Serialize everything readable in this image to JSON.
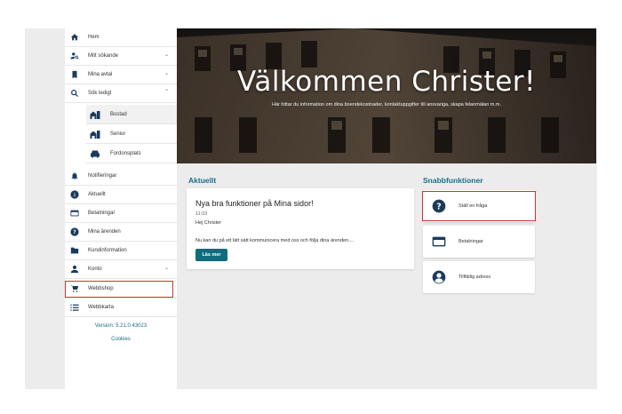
{
  "sidebar": {
    "items": [
      {
        "label": "Hem",
        "icon": "home-icon"
      },
      {
        "label": "Mitt sökande",
        "icon": "person-search-icon"
      },
      {
        "label": "Mina avtal",
        "icon": "book-icon"
      },
      {
        "label": "Sök ledigt",
        "icon": "search-icon"
      },
      {
        "label": "Notifieringar",
        "icon": "bell-icon"
      },
      {
        "label": "Aktuellt",
        "icon": "info-icon"
      },
      {
        "label": "Betalningar",
        "icon": "credit-card-icon"
      },
      {
        "label": "Mina ärenden",
        "icon": "help-circle-icon"
      },
      {
        "label": "Kundinformation",
        "icon": "folder-icon"
      },
      {
        "label": "Konto",
        "icon": "account-icon"
      },
      {
        "label": "Webbshop",
        "icon": "cart-icon"
      },
      {
        "label": "Webbkarta",
        "icon": "list-icon"
      }
    ],
    "sub_items": [
      {
        "label": "Bostad",
        "icon": "apartment-icon"
      },
      {
        "label": "Senior",
        "icon": "apartment-icon"
      },
      {
        "label": "Fordonsplats",
        "icon": "car-icon"
      }
    ],
    "version": "Version: 5.21.0.43023",
    "cookies": "Cookies"
  },
  "hero": {
    "title": "Välkommen Christer!",
    "subtitle": "Här hittar du information om dina boendekostnader, kontaktuppgifter till ansvariga, skapa felanmälan m.m."
  },
  "news": {
    "section_title": "Aktuellt",
    "title": "Nya bra funktioner på Mina sidor!",
    "time": "11:03",
    "greeting": "Hej Christer",
    "body": "Nu kan du på ett lätt sätt kommunicera med oss och följa dina ärenden....",
    "button": "Läs mer"
  },
  "quick": {
    "section_title": "Snabbfunktioner",
    "items": [
      {
        "label": "Ställ en fråga",
        "icon": "help-circle-icon"
      },
      {
        "label": "Betalningar",
        "icon": "credit-card-icon"
      },
      {
        "label": "Tillfällig adress",
        "icon": "account-circle-icon"
      }
    ]
  },
  "colors": {
    "accent": "#0f6b7d",
    "heading": "#1b6e8a",
    "highlight": "#d0342c",
    "icon": "#1b3a5c"
  }
}
